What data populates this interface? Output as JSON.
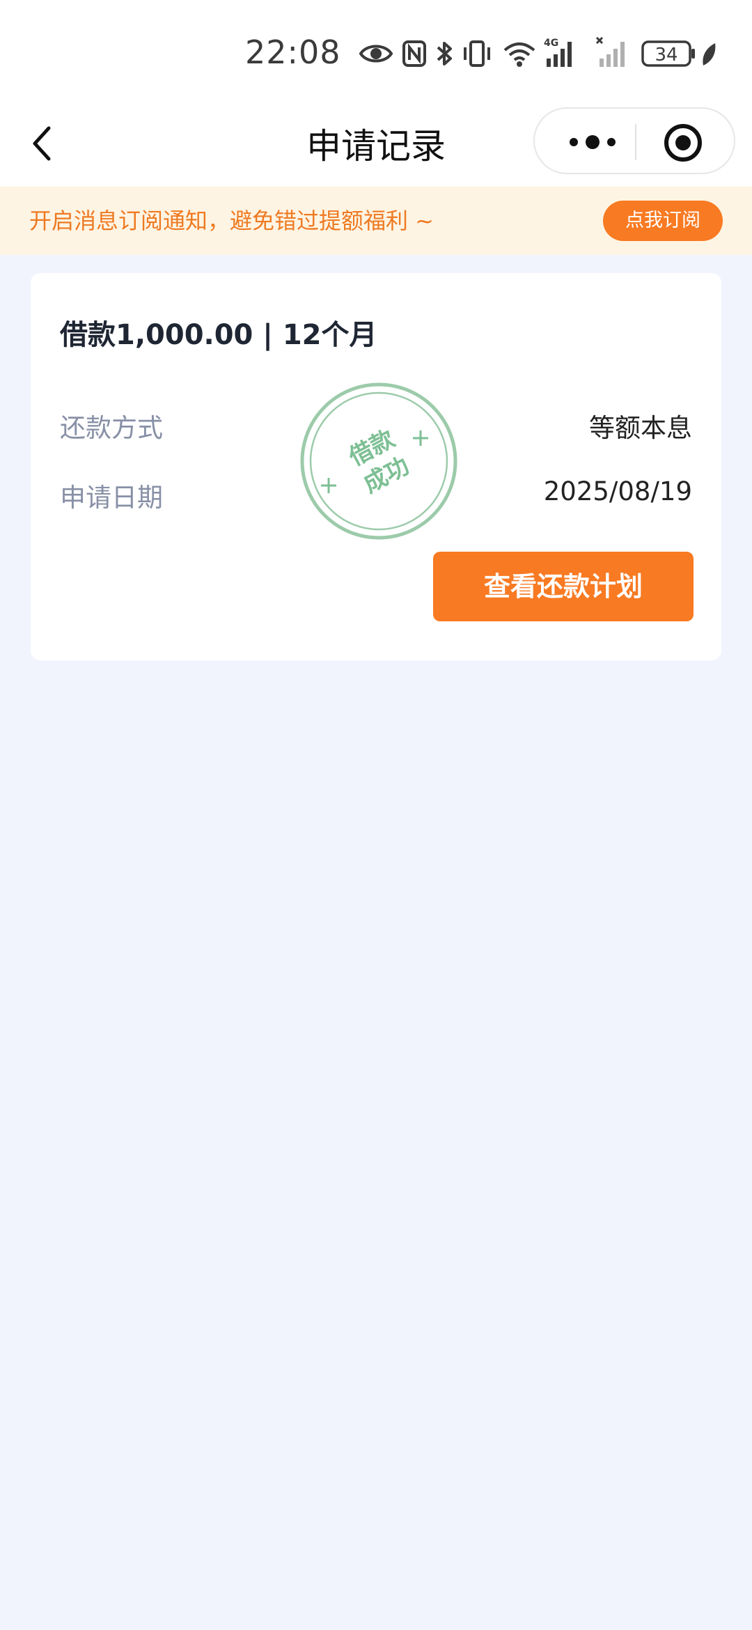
{
  "status_bar": {
    "time": "22:08",
    "network": "4G",
    "battery": "34",
    "icons": [
      "eye-icon",
      "nfc-icon",
      "bluetooth-icon",
      "vibrate-icon",
      "wifi-icon",
      "signal-4g-icon",
      "signal-no-sim-icon",
      "battery-icon",
      "leaf-icon"
    ]
  },
  "nav": {
    "title": "申请记录",
    "back_icon": "chevron-left-icon",
    "more_icon": "more-dots-icon",
    "close_icon": "target-icon"
  },
  "notice": {
    "text": "开启消息订阅通知，避免错过提额福利 ~",
    "button_label": "点我订阅"
  },
  "record": {
    "title": "借款1,000.00 | 12个月",
    "rows": [
      {
        "label": "还款方式",
        "value": "等额本息"
      },
      {
        "label": "申请日期",
        "value": "2025/08/19"
      }
    ],
    "stamp": {
      "line1": "借款",
      "line2": "成功",
      "color": "#7dbf94"
    },
    "button_label": "查看还款计划"
  },
  "colors": {
    "accent": "#f87a22",
    "notice_bg": "#fef4e3",
    "page_bg": "#f1f4fd"
  }
}
